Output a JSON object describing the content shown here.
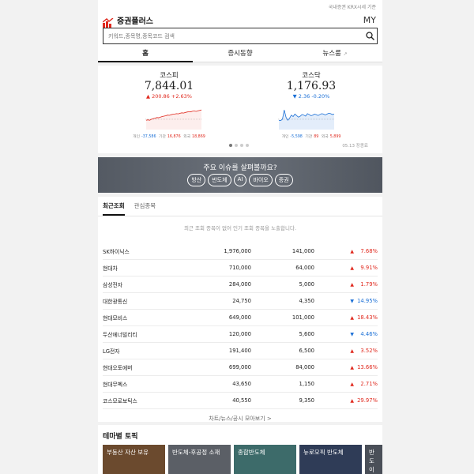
{
  "header": {
    "top_note": "국내증권 KRX시세 기준",
    "app_name": "증권플러스",
    "my_label": "MY",
    "search_placeholder": "키워드,종목명,종목코드 검색"
  },
  "tabs": [
    {
      "label": "홈",
      "active": true
    },
    {
      "label": "증시동향",
      "active": false
    },
    {
      "label": "뉴스룸",
      "active": false,
      "external": "↗"
    }
  ],
  "indices": [
    {
      "name": "코스피",
      "value": "7,844.01",
      "arrow": "▲",
      "change": "200.86",
      "rate": "+2.63%",
      "direction": "up",
      "investors": [
        {
          "label": "개인",
          "value": "-37,586"
        },
        {
          "label": "기관",
          "value": "16,876"
        },
        {
          "label": "외국",
          "value": "18,869"
        }
      ],
      "spark": [
        0.3,
        0.32,
        0.3,
        0.35,
        0.38,
        0.4,
        0.43,
        0.42,
        0.45,
        0.48,
        0.5,
        0.52,
        0.55,
        0.54,
        0.57,
        0.59,
        0.6,
        0.62,
        0.61,
        0.64,
        0.66,
        0.65,
        0.68,
        0.7,
        0.72,
        0.71,
        0.74,
        0.75,
        0.73,
        0.76,
        0.78,
        0.8
      ]
    },
    {
      "name": "코스닥",
      "value": "1,176.93",
      "arrow": "▼",
      "change": "2.36",
      "rate": "-0.20%",
      "direction": "down",
      "investors": [
        {
          "label": "개인",
          "value": "-5,598"
        },
        {
          "label": "기관",
          "value": "89"
        },
        {
          "label": "외국",
          "value": "5,899"
        }
      ],
      "spark": [
        0.3,
        0.28,
        0.35,
        0.8,
        0.45,
        0.3,
        0.4,
        0.55,
        0.48,
        0.6,
        0.52,
        0.45,
        0.5,
        0.58,
        0.55,
        0.5,
        0.62,
        0.58,
        0.52,
        0.55,
        0.6,
        0.57,
        0.53,
        0.58,
        0.62,
        0.6,
        0.56,
        0.6,
        0.64,
        0.62,
        0.58,
        0.6
      ]
    }
  ],
  "index_date": "05.13 장종료",
  "issue": {
    "title": "주요 이슈를 살펴볼까요?",
    "chips": [
      "방산",
      "반도체",
      "AI",
      "바이오",
      "증권"
    ]
  },
  "recent": {
    "tabs": [
      "최근조회",
      "관심종목"
    ],
    "notice": "최근 조회 종목이 없어 인기 조회 종목을 노출합니다.",
    "rows": [
      {
        "name": "SK하이닉스",
        "price": "1,976,000",
        "change": "141,000",
        "arrow": "▲",
        "rate": "7.68%",
        "dir": "up"
      },
      {
        "name": "현대차",
        "price": "710,000",
        "change": "64,000",
        "arrow": "▲",
        "rate": "9.91%",
        "dir": "up"
      },
      {
        "name": "삼성전자",
        "price": "284,000",
        "change": "5,000",
        "arrow": "▲",
        "rate": "1.79%",
        "dir": "up"
      },
      {
        "name": "대한광통신",
        "price": "24,750",
        "change": "4,350",
        "arrow": "▼",
        "rate": "14.95%",
        "dir": "down"
      },
      {
        "name": "현대모비스",
        "price": "649,000",
        "change": "101,000",
        "arrow": "▲",
        "rate": "18.43%",
        "dir": "up"
      },
      {
        "name": "두산에너빌리티",
        "price": "120,000",
        "change": "5,600",
        "arrow": "▼",
        "rate": "4.46%",
        "dir": "down"
      },
      {
        "name": "LG전자",
        "price": "191,400",
        "change": "6,500",
        "arrow": "▲",
        "rate": "3.52%",
        "dir": "up"
      },
      {
        "name": "현대오토에버",
        "price": "699,000",
        "change": "84,000",
        "arrow": "▲",
        "rate": "13.66%",
        "dir": "up"
      },
      {
        "name": "현대무벡스",
        "price": "43,650",
        "change": "1,150",
        "arrow": "▲",
        "rate": "2.71%",
        "dir": "up"
      },
      {
        "name": "코스모로보틱스",
        "price": "40,550",
        "change": "9,350",
        "arrow": "▲",
        "rate": "29.97%",
        "dir": "up"
      }
    ],
    "more_link": "차트/뉴스/공시 모아보기 >"
  },
  "theme": {
    "title": "테마별 토픽",
    "cards": [
      {
        "label": "부동산 자산 보유",
        "color": "#6b4a2e"
      },
      {
        "label": "반도체-후공정 소재",
        "color": "#5b5f66"
      },
      {
        "label": "종합반도체",
        "color": "#3d6b6a"
      },
      {
        "label": "뉴로모픽 반도체",
        "color": "#2f3c57"
      },
      {
        "label": "반도 이송장",
        "color": "#4a4f58"
      }
    ]
  },
  "colors": {
    "up": "#e0291e",
    "down": "#1a6fd6",
    "accent": "#e0291e"
  }
}
